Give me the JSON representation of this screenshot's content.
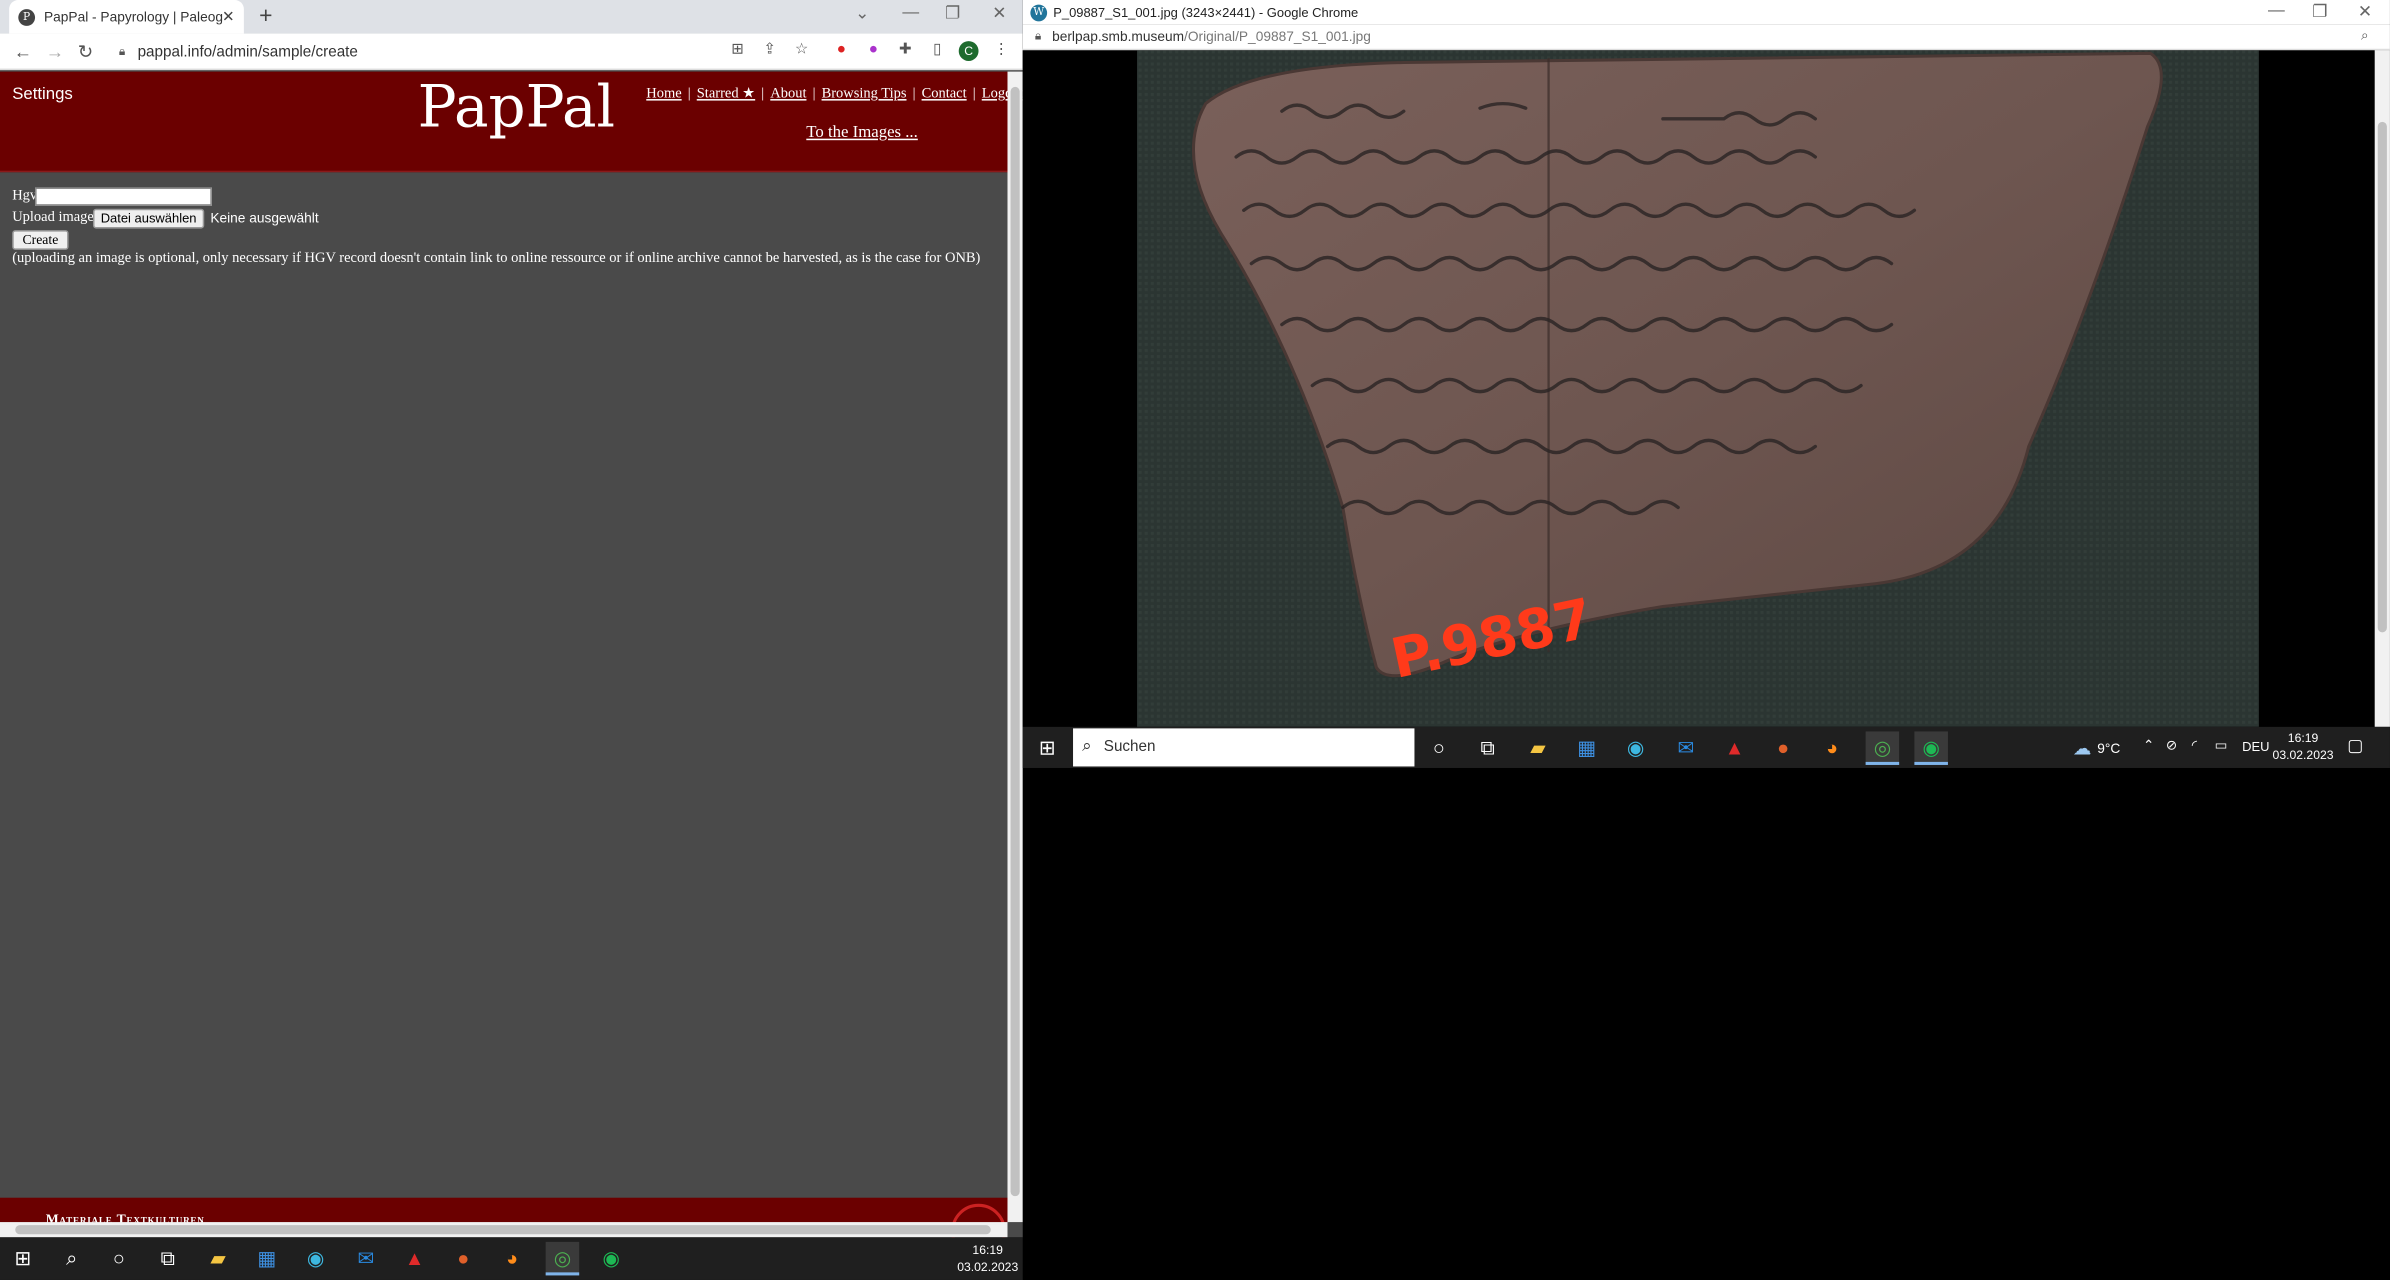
{
  "left_window": {
    "tab_title": "PapPal - Papyrology | Paleograph",
    "tab_favicon": "P",
    "url": "pappal.info/admin/sample/create",
    "profile_initial": "C"
  },
  "page": {
    "settings": "Settings",
    "logo": "PapPal",
    "nav": [
      "Home",
      "Starred ★",
      "About",
      "Browsing Tips",
      "Contact",
      "Logout"
    ],
    "to_images": "To the Images ...",
    "hgv_label": "Hgv",
    "hgv_value": "",
    "upload_label": "Upload image",
    "file_button": "Datei auswählen",
    "file_status": "Keine ausgewählt",
    "create_button": "Create",
    "note": "(uploading an image is optional, only necessary if HGV record doesn't contain link to online ressource or if online archive cannot be harvested, as is the case for ONB)",
    "footer_text": "Materiale Textkulturen"
  },
  "right_window": {
    "title": "P_09887_S1_001.jpg (3243×2441) - Google Chrome",
    "url_host": "berlpap.smb.museum",
    "url_path": "/Original/P_09887_S1_001.jpg",
    "ostracon_label": "P.9887"
  },
  "taskbar_left": {
    "time": "16:19",
    "date": "03.02.2023"
  },
  "taskbar_right": {
    "search_placeholder": "Suchen",
    "weather": "9°C",
    "language": "DEU",
    "time": "16:19",
    "date": "03.02.2023"
  },
  "colors": {
    "header_red": "#6b0000",
    "page_bg": "#4a4a4a",
    "taskbar_bg": "#1f1f1f",
    "ostracon_label_red": "#ff3a1a"
  }
}
